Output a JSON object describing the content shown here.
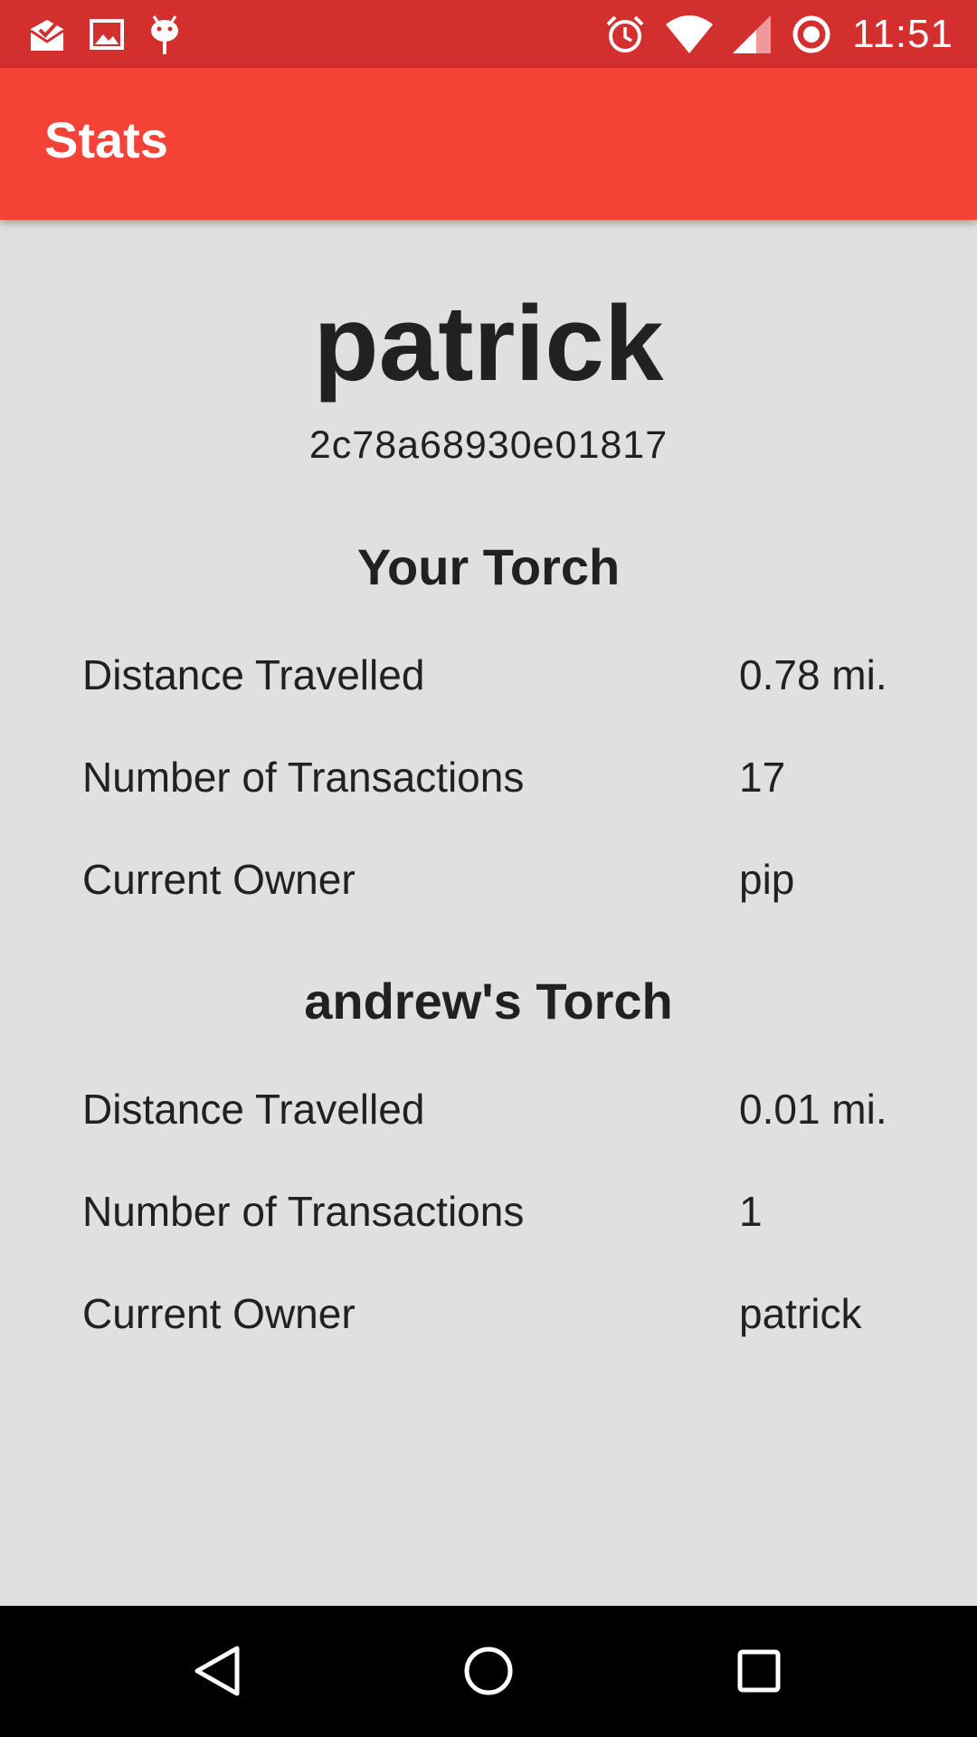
{
  "status_bar": {
    "time": "11:51",
    "left_icons": [
      "mail-check-icon",
      "image-icon",
      "android-debug-icon"
    ],
    "right_icons": [
      "alarm-icon",
      "wifi-icon",
      "cell-signal-icon",
      "sync-ring-icon"
    ],
    "background": "#d32f2f"
  },
  "app_bar": {
    "title": "Stats",
    "background": "#f44336"
  },
  "profile": {
    "name": "patrick",
    "id": "2c78a68930e01817"
  },
  "sections": [
    {
      "title": "Your Torch",
      "rows": [
        {
          "label": "Distance Travelled",
          "value": "0.78 mi."
        },
        {
          "label": "Number of Transactions",
          "value": "17"
        },
        {
          "label": "Current Owner",
          "value": "pip"
        }
      ]
    },
    {
      "title": "andrew's Torch",
      "rows": [
        {
          "label": "Distance Travelled",
          "value": "0.01 mi."
        },
        {
          "label": "Number of Transactions",
          "value": "1"
        },
        {
          "label": "Current Owner",
          "value": "patrick"
        }
      ]
    }
  ],
  "nav_bar": {
    "buttons": [
      "back-icon",
      "home-icon",
      "recents-icon"
    ]
  }
}
